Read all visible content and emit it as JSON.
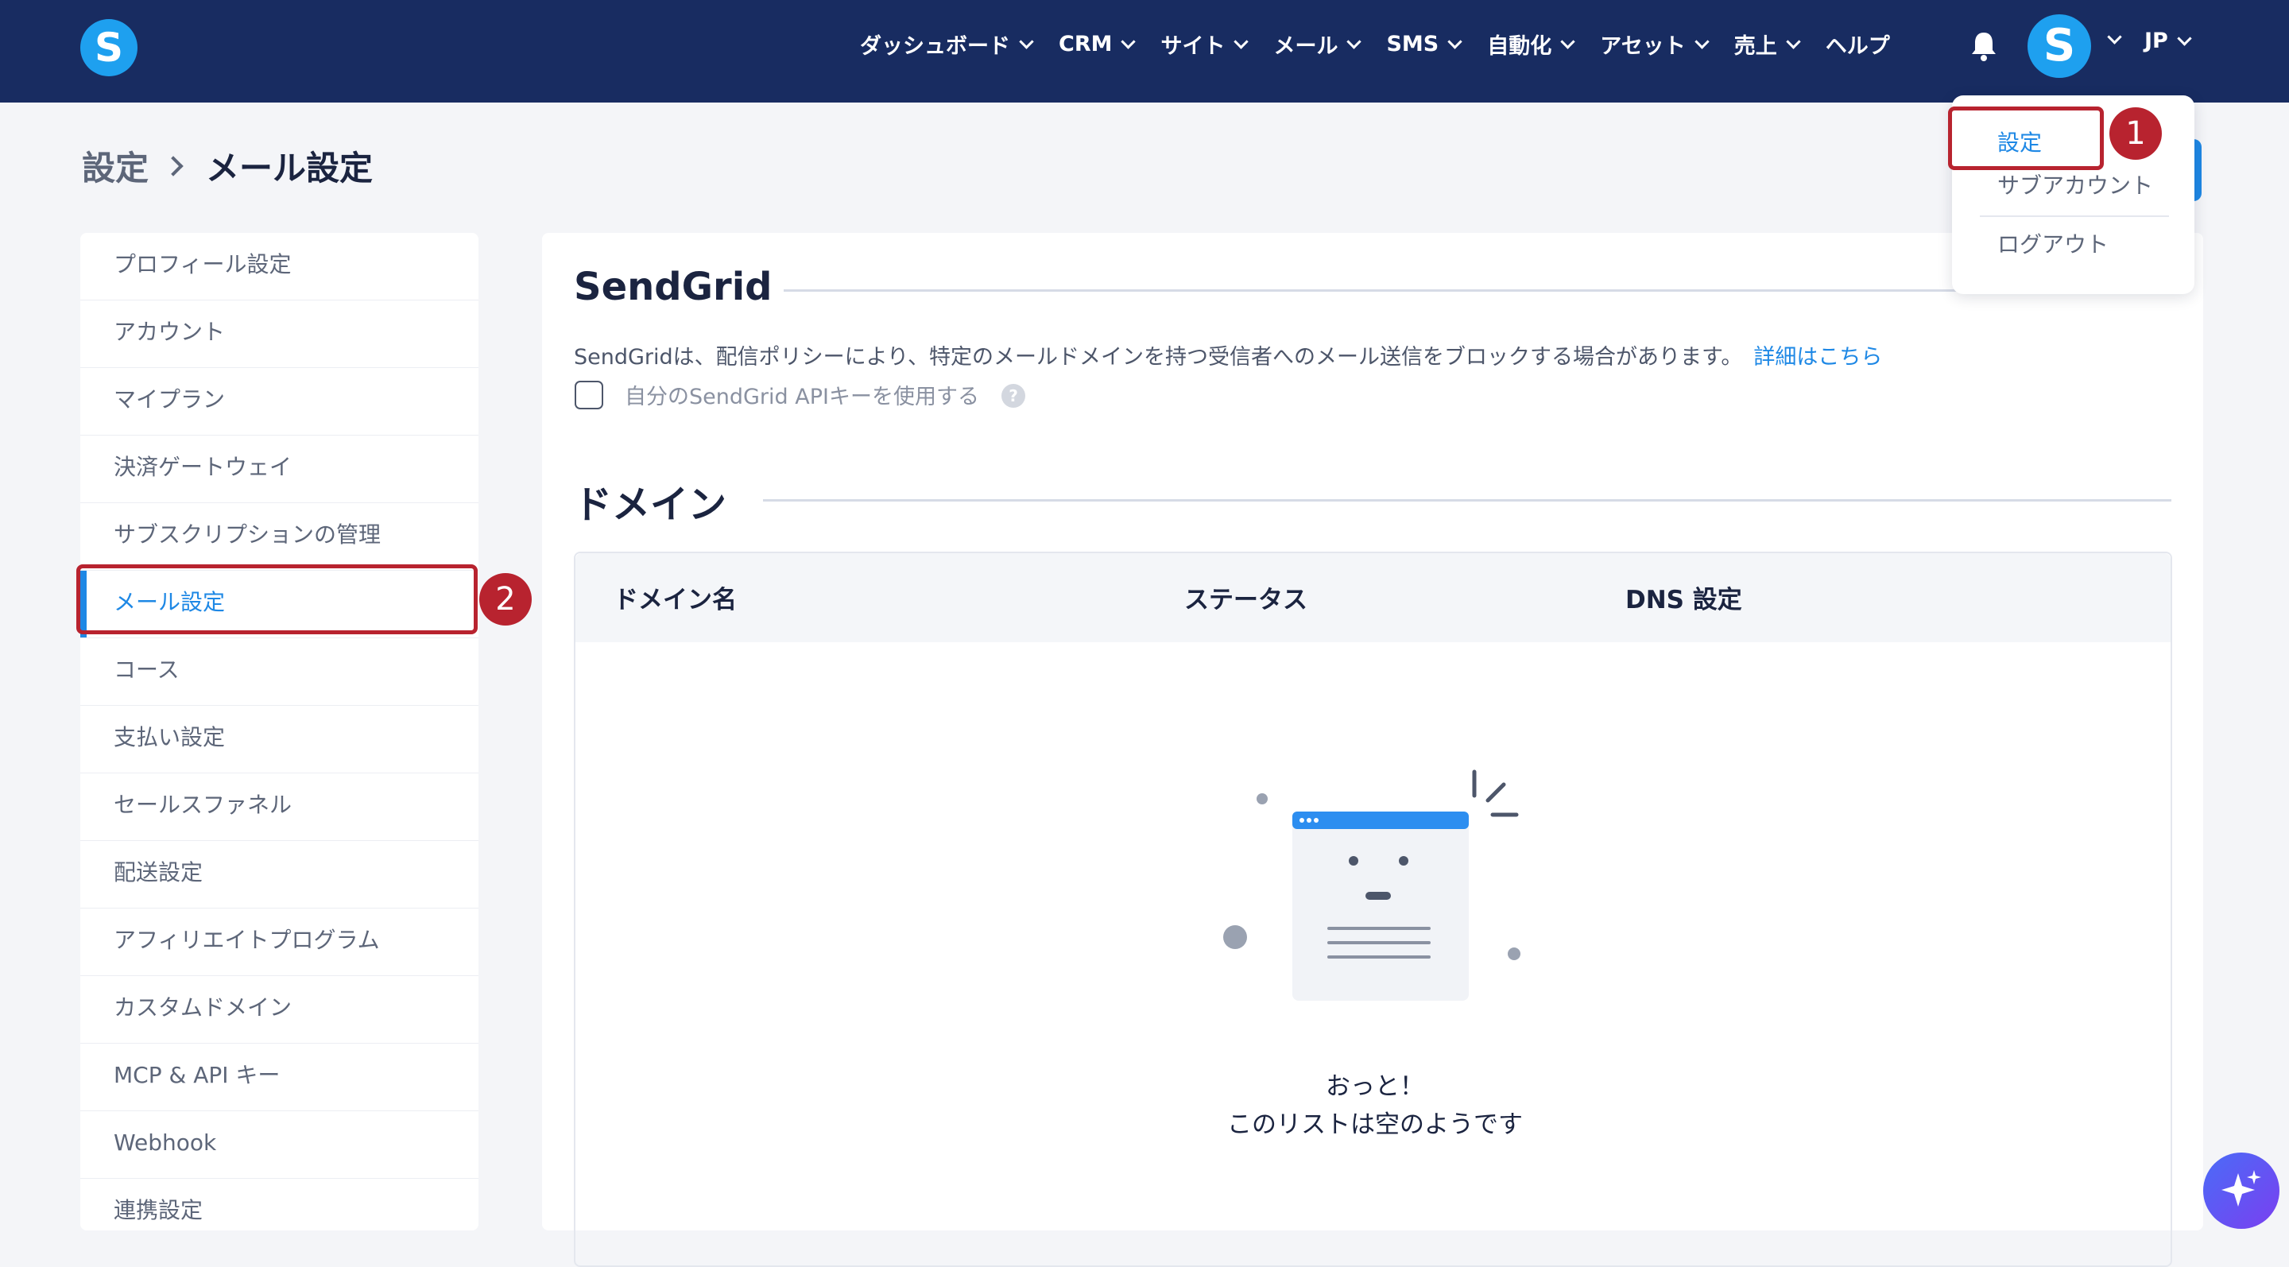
{
  "header": {
    "logo_letter": "S",
    "nav": [
      {
        "label": "ダッシュボード"
      },
      {
        "label": "CRM"
      },
      {
        "label": "サイト"
      },
      {
        "label": "メール"
      },
      {
        "label": "SMS"
      },
      {
        "label": "自動化"
      },
      {
        "label": "アセット"
      },
      {
        "label": "売上"
      }
    ],
    "help_label": "ヘルプ",
    "avatar_letter": "S",
    "language": "JP"
  },
  "account_menu": {
    "items": [
      {
        "label": "設定",
        "active": true
      },
      {
        "label": "サブアカウント"
      },
      {
        "label": "ログアウト"
      }
    ]
  },
  "annotations": {
    "badge1": "1",
    "badge2": "2",
    "highlight_color": "#b8232f"
  },
  "breadcrumb": {
    "parent": "設定",
    "current": "メール設定"
  },
  "sidebar": {
    "items": [
      {
        "label": "プロフィール設定"
      },
      {
        "label": "アカウント"
      },
      {
        "label": "マイプラン"
      },
      {
        "label": "決済ゲートウェイ"
      },
      {
        "label": "サブスクリプションの管理"
      },
      {
        "label": "メール設定",
        "active": true
      },
      {
        "label": "コース"
      },
      {
        "label": "支払い設定"
      },
      {
        "label": "セールスファネル"
      },
      {
        "label": "配送設定"
      },
      {
        "label": "アフィリエイトプログラム"
      },
      {
        "label": "カスタムドメイン"
      },
      {
        "label": "MCP & API キー"
      },
      {
        "label": "Webhook"
      },
      {
        "label": "連携設定"
      }
    ]
  },
  "sendgrid": {
    "title": "SendGrid",
    "description": "SendGridは、配信ポリシーにより、特定のメールドメインを持つ受信者へのメール送信をブロックする場合があります。",
    "link": "詳細はこちら",
    "checkbox_label": "自分のSendGrid APIキーを使用する",
    "checkbox_checked": false,
    "help_glyph": "?"
  },
  "domain": {
    "title": "ドメイン",
    "columns": [
      "ドメイン名",
      "ステータス",
      "DNS 設定"
    ],
    "empty_title": "おっと！",
    "empty_message": "このリストは空のようです"
  },
  "colors": {
    "header_bg": "#182c61",
    "accent": "#1e88e5",
    "page_bg": "#f4f5f8"
  }
}
